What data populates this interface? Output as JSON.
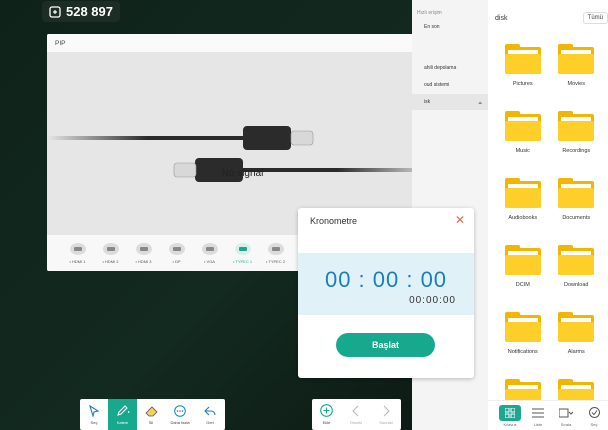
{
  "room": {
    "id": "528 897"
  },
  "pip": {
    "title": "PIP",
    "no_signal": "No signal",
    "sources": [
      {
        "label": "• HDMI 1",
        "active": false
      },
      {
        "label": "• HDMI 2",
        "active": false
      },
      {
        "label": "• HDMI 3",
        "active": false
      },
      {
        "label": "• DP",
        "active": false
      },
      {
        "label": "• VGA",
        "active": false
      },
      {
        "label": "• TYPEC 1",
        "active": true
      },
      {
        "label": "• TYPEC 2",
        "active": false
      }
    ]
  },
  "sidebar": {
    "title": "Hızlı erişim",
    "items": [
      {
        "label": "En son"
      },
      {
        "label": "ahili depolama"
      },
      {
        "label": "oud sistemi"
      },
      {
        "label": "isk",
        "selected": true
      }
    ]
  },
  "files": {
    "location": "disk",
    "filter": "Tümü",
    "folders": [
      "Pictures",
      "Movies",
      "Music",
      "Recordings",
      "Audiobooks",
      "Documents",
      "DCIM",
      "Download",
      "Notifications",
      "Alarms",
      "",
      ""
    ],
    "footer": [
      {
        "label": "Kılavuz",
        "active": true
      },
      {
        "label": "Liste",
        "active": false
      },
      {
        "label": "Sırala",
        "active": false
      },
      {
        "label": "Seç",
        "active": false
      }
    ]
  },
  "stopwatch": {
    "title": "Kronometre",
    "time": "00 : 00 : 00",
    "sub": "00:00:00",
    "start": "Başlat"
  },
  "toolbar_left": [
    {
      "label": "Seç",
      "icon": "select-icon"
    },
    {
      "label": "Kalem",
      "icon": "pen-icon",
      "active": true
    },
    {
      "label": "Sil",
      "icon": "eraser-icon"
    },
    {
      "label": "Daha fazla",
      "icon": "more-icon"
    },
    {
      "label": "Geri",
      "icon": "undo-icon"
    }
  ],
  "toolbar_right": [
    {
      "label": "Ekle",
      "icon": "add-icon"
    },
    {
      "label": "Önceki",
      "icon": "prev-icon"
    },
    {
      "label": "Sonraki",
      "icon": "next-icon"
    }
  ],
  "colors": {
    "accent": "#17a98d",
    "folder": "#ffcf29",
    "digits": "#1a7fbf"
  }
}
